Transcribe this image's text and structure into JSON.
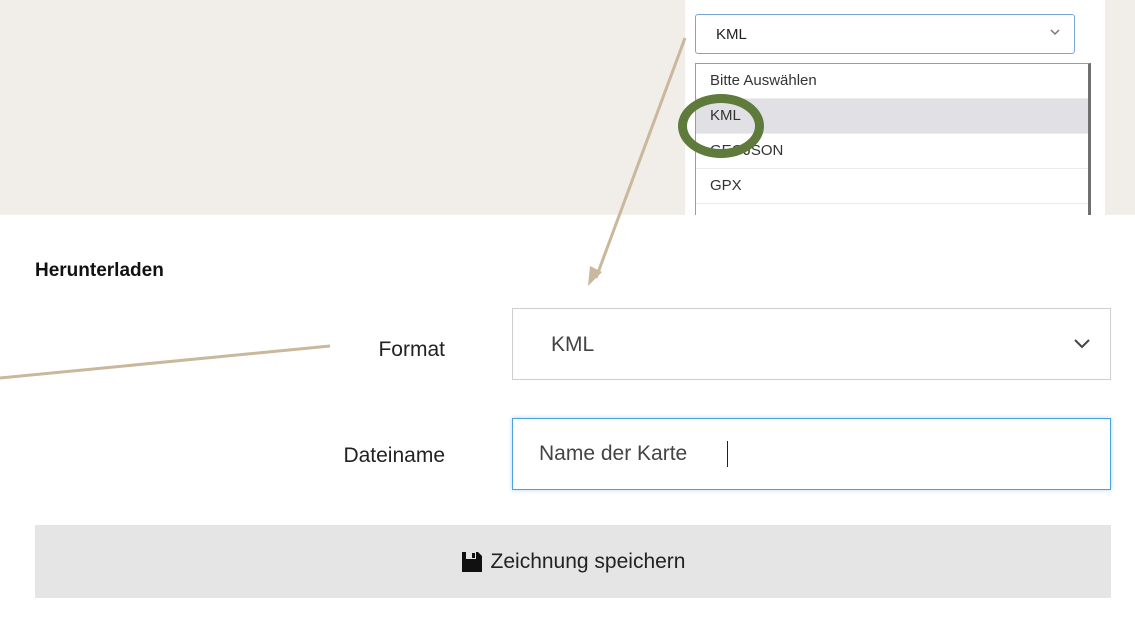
{
  "callout": {
    "select_value": "KML",
    "options": [
      "Bitte Auswählen",
      "KML",
      "GEOJSON",
      "GPX"
    ],
    "selected_index": 1
  },
  "form": {
    "section_title": "Herunterladen",
    "format_label": "Format",
    "format_value": "KML",
    "filename_label": "Dateiname",
    "filename_value": "Name der Karte",
    "save_label": "Zeichnung speichern"
  },
  "colors": {
    "background": "#f1ede8",
    "connector": "#c9b89c",
    "highlight_ring": "#5f7b3b",
    "focus_border": "#4ea1df",
    "button_bg": "#e5e5e5"
  },
  "icons": {
    "save": "floppy-disk-icon",
    "chevron": "chevron-down-icon"
  }
}
